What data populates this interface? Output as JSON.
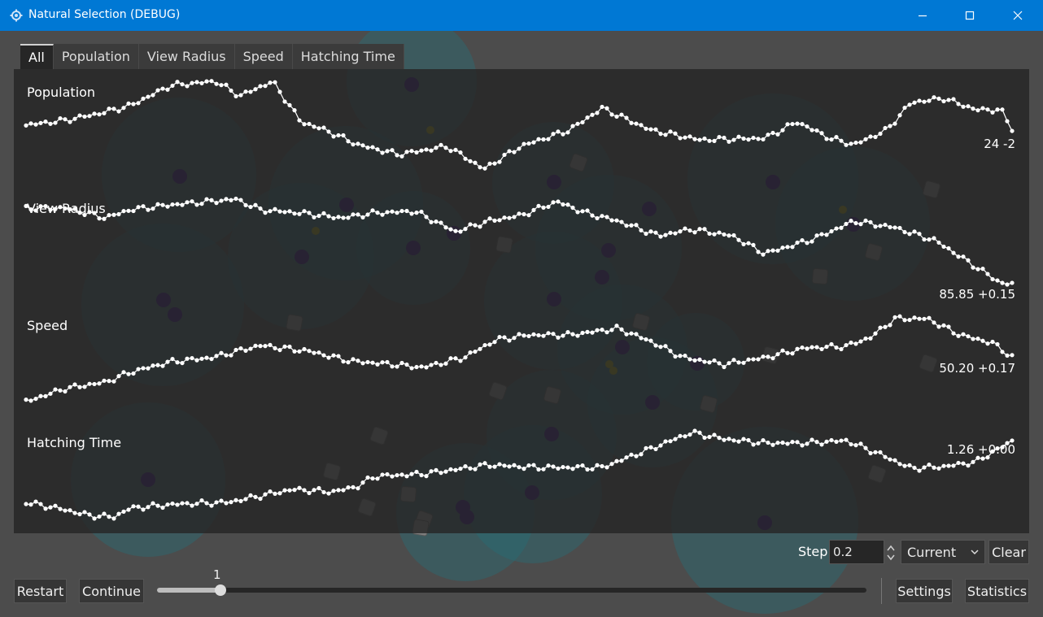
{
  "window": {
    "title": "Natural Selection (DEBUG)"
  },
  "tabs": [
    "All",
    "Population",
    "View Radius",
    "Speed",
    "Hatching Time"
  ],
  "active_tab": "All",
  "graphs": [
    {
      "label": "Population",
      "value": "24 -2"
    },
    {
      "label": "View Radius",
      "value": "85.85 +0.15"
    },
    {
      "label": "Speed",
      "value": "50.20 +0.17"
    },
    {
      "label": "Hatching Time",
      "value": "1.26 +0.00"
    }
  ],
  "controls": {
    "step_label": "Step",
    "step_value": "0.2",
    "mode_select": "Current",
    "clear_label": "Clear",
    "restart_label": "Restart",
    "continue_label": "Continue",
    "speed_slider_value": "1",
    "settings_label": "Settings",
    "statistics_label": "Statistics"
  },
  "colors": {
    "titlebar": "#0078d4",
    "background": "#4c4c4c",
    "graph_panel": "rgba(38,38,38,0.82)",
    "view_circle": "rgba(38,110,118,0.42)",
    "creature": "#35126e",
    "food": "#8e8a16",
    "obstacle": "#7e7e7e",
    "graph_line": "#ffffff"
  },
  "icons": [
    "app-gear-icon",
    "minimize-icon",
    "maximize-icon",
    "close-icon",
    "spin-arrows-icon",
    "chevron-down-icon"
  ]
}
